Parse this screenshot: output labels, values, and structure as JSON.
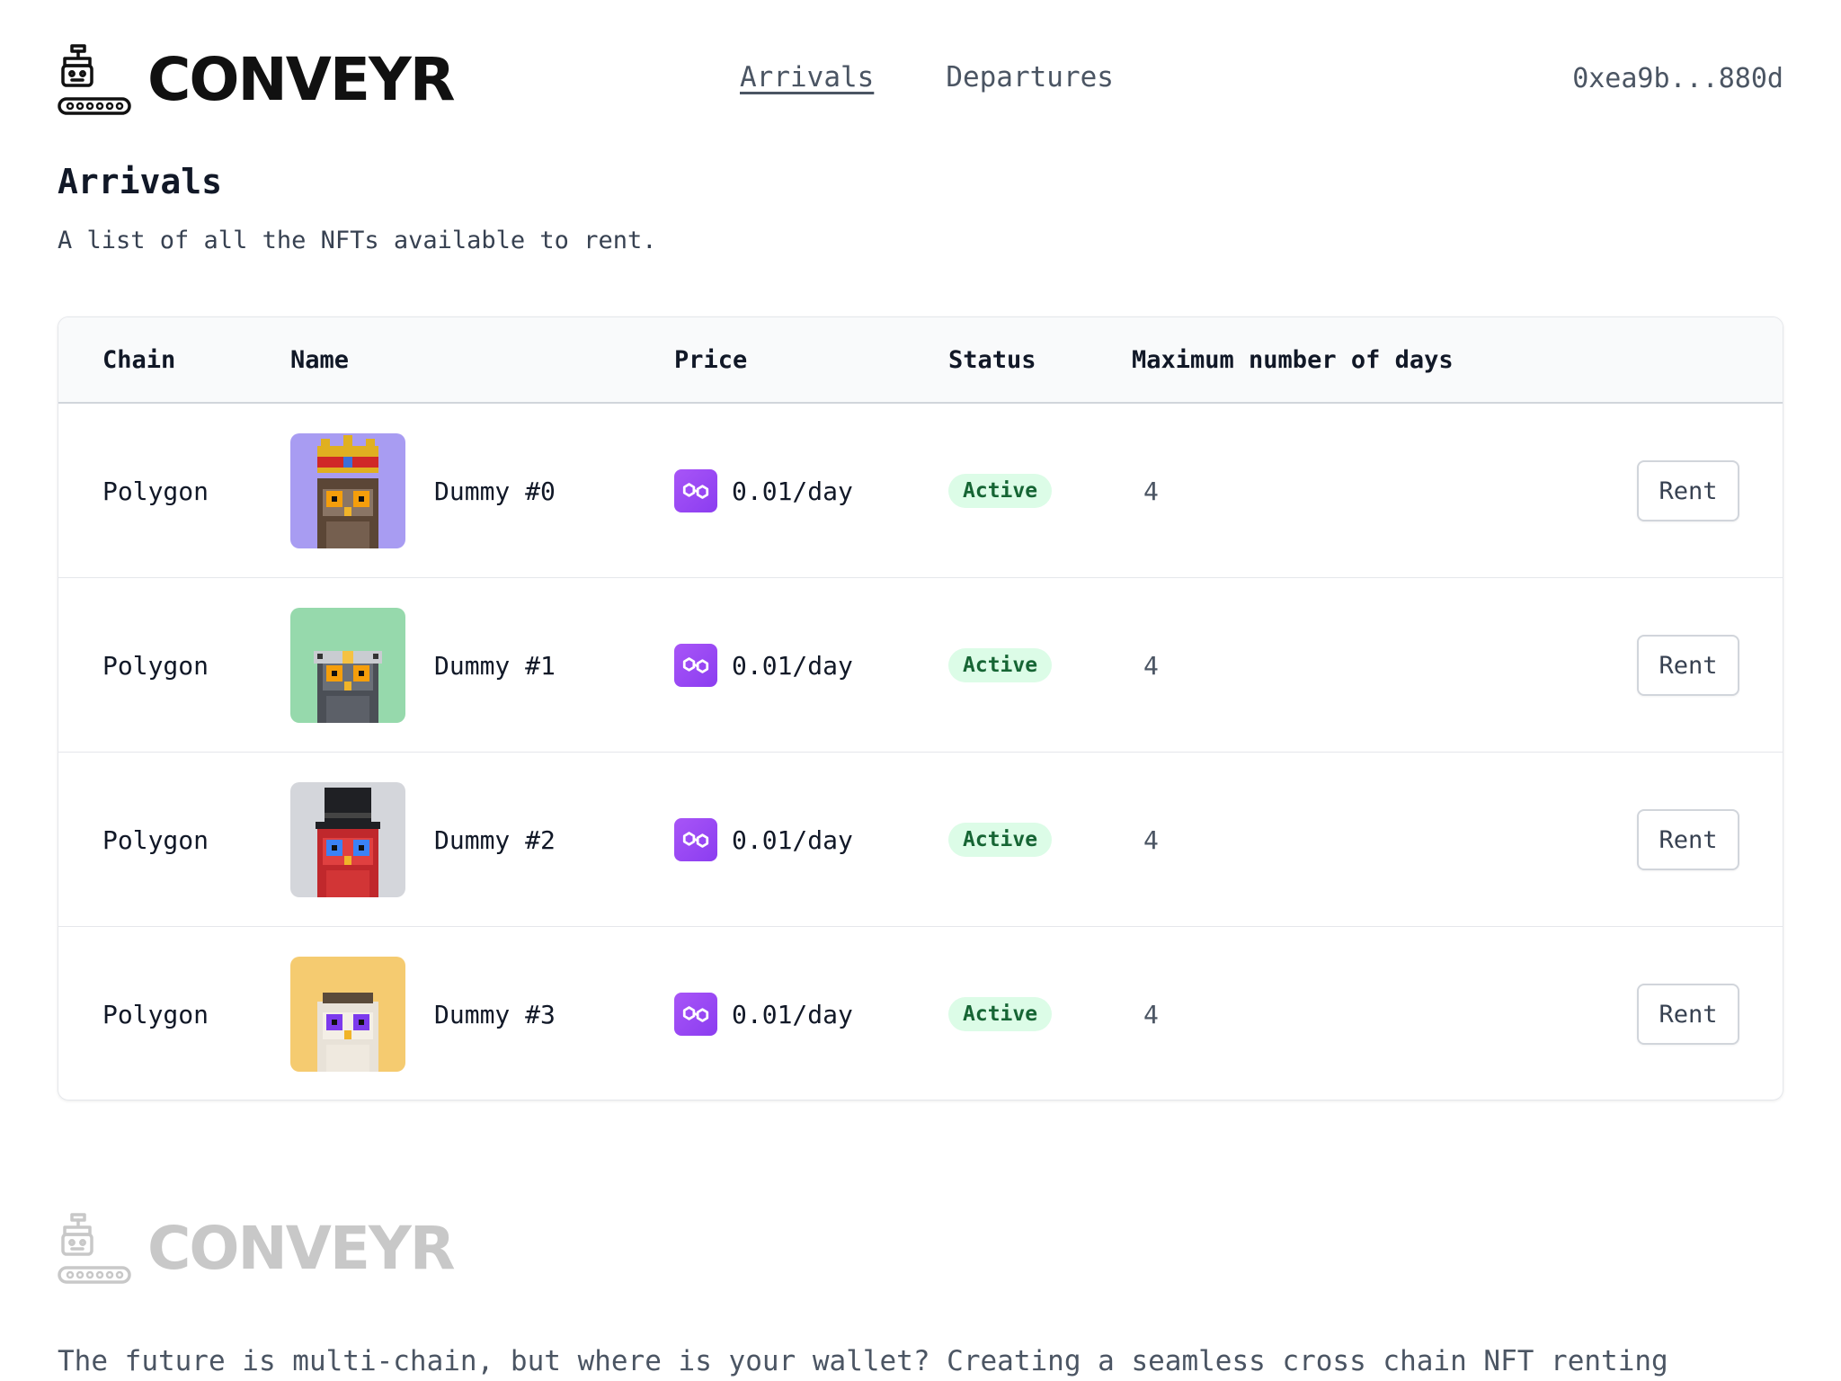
{
  "header": {
    "brand": "CONVEYR",
    "nav": [
      {
        "label": "Arrivals",
        "current": true
      },
      {
        "label": "Departures",
        "current": false
      }
    ],
    "wallet": "0xea9b...880d"
  },
  "main": {
    "title": "Arrivals",
    "description": "A list of all the NFTs available to rent."
  },
  "table": {
    "columns": [
      "Chain",
      "Name",
      "Price",
      "Status",
      "Maximum number of days"
    ],
    "rows": [
      {
        "chain": "Polygon",
        "name": "Dummy #0",
        "price": "0.01/day",
        "status": "Active",
        "max_days": "4",
        "action": "Rent",
        "bg": "#a89cf2",
        "variant": "crown"
      },
      {
        "chain": "Polygon",
        "name": "Dummy #1",
        "price": "0.01/day",
        "status": "Active",
        "max_days": "4",
        "action": "Rent",
        "bg": "#96d9ac",
        "variant": "headband"
      },
      {
        "chain": "Polygon",
        "name": "Dummy #2",
        "price": "0.01/day",
        "status": "Active",
        "max_days": "4",
        "action": "Rent",
        "bg": "#d4d6db",
        "variant": "tophat"
      },
      {
        "chain": "Polygon",
        "name": "Dummy #3",
        "price": "0.01/day",
        "status": "Active",
        "max_days": "4",
        "action": "Rent",
        "bg": "#f5cb70",
        "variant": "plain"
      }
    ]
  },
  "footer": {
    "brand": "CONVEYR",
    "tagline": "The future is multi-chain, but where is your wallet? Creating a seamless cross chain NFT renting"
  },
  "colors": {
    "badge_bg": "#dcfce7",
    "badge_text": "#166534",
    "matic_purple": "#8b3df0"
  },
  "icons": {
    "logo": "conveyor-robot-icon",
    "price": "polygon-matic-icon"
  }
}
